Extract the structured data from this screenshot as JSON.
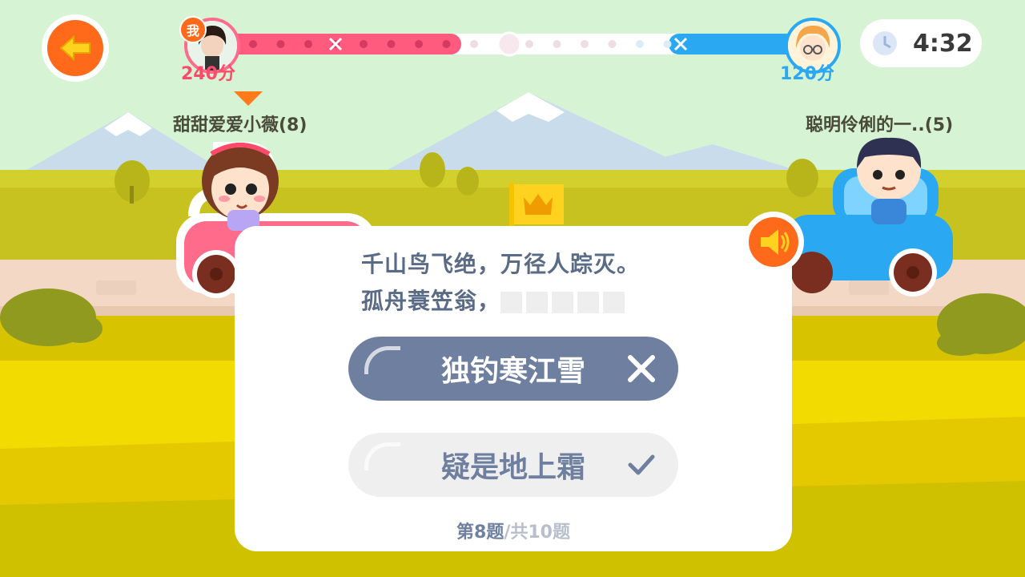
{
  "header": {
    "me_badge": "我",
    "left_score": "240分",
    "right_score": "120分",
    "timer": "4:32",
    "progress_left": 0.4,
    "progress_right": 0.25
  },
  "players": {
    "left_name": "甜甜爱爱小薇(8)",
    "right_name": "聪明伶俐的一..(5)"
  },
  "question": {
    "line1": "千山鸟飞绝，万径人踪灭。",
    "line2": "孤舟蓑笠翁，",
    "blank_count": 5,
    "options": [
      {
        "label": "独钓寒江雪",
        "state": "wrong"
      },
      {
        "label": "疑是地上霜",
        "state": "correct"
      }
    ],
    "counter_current": "第8题",
    "counter_total": "/共10题"
  },
  "colors": {
    "accent": "#ff6a1a",
    "pink": "#ff6b8a",
    "blue": "#2aa8f2",
    "option_wrong": "#6e7fa0"
  },
  "icons": [
    "back-arrow-icon",
    "clock-icon",
    "speaker-icon",
    "cross-icon",
    "check-icon",
    "crown-icon"
  ]
}
